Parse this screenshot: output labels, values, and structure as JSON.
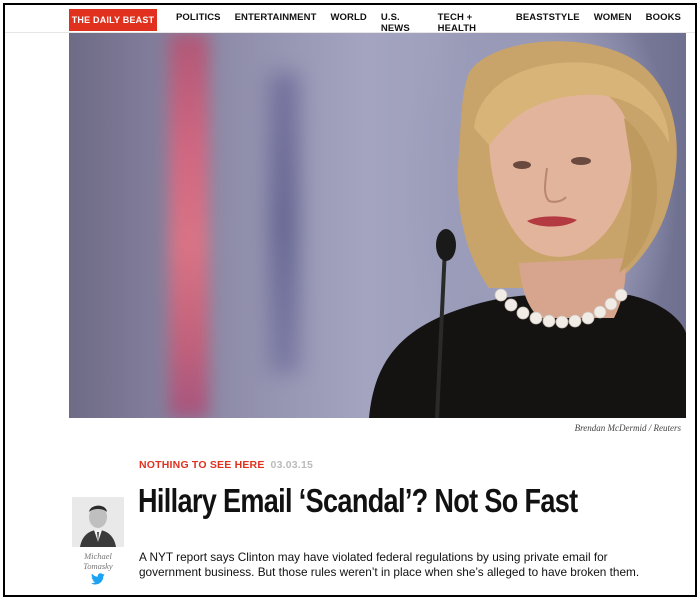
{
  "header": {
    "logo": "THE DAILY BEAST",
    "nav": [
      "POLITICS",
      "ENTERTAINMENT",
      "WORLD",
      "U.S. NEWS",
      "TECH + HEALTH",
      "BEASTSTYLE",
      "WOMEN",
      "BOOKS"
    ]
  },
  "hero": {
    "credit": "Brendan McDermid / Reuters"
  },
  "article": {
    "kicker": "NOTHING TO SEE HERE",
    "date": "03.03.15",
    "headline": "Hillary Email ‘Scandal’? Not So Fast",
    "dek": "A NYT report says Clinton may have violated federal regulations by using private email for government business. But those rules weren’t in place when she’s alleged to have broken them."
  },
  "author": {
    "first": "Michael",
    "last": "Tomasky",
    "social_icon": "twitter-icon"
  },
  "colors": {
    "brand_red": "#e0311e",
    "twitter_blue": "#1da1f2"
  }
}
